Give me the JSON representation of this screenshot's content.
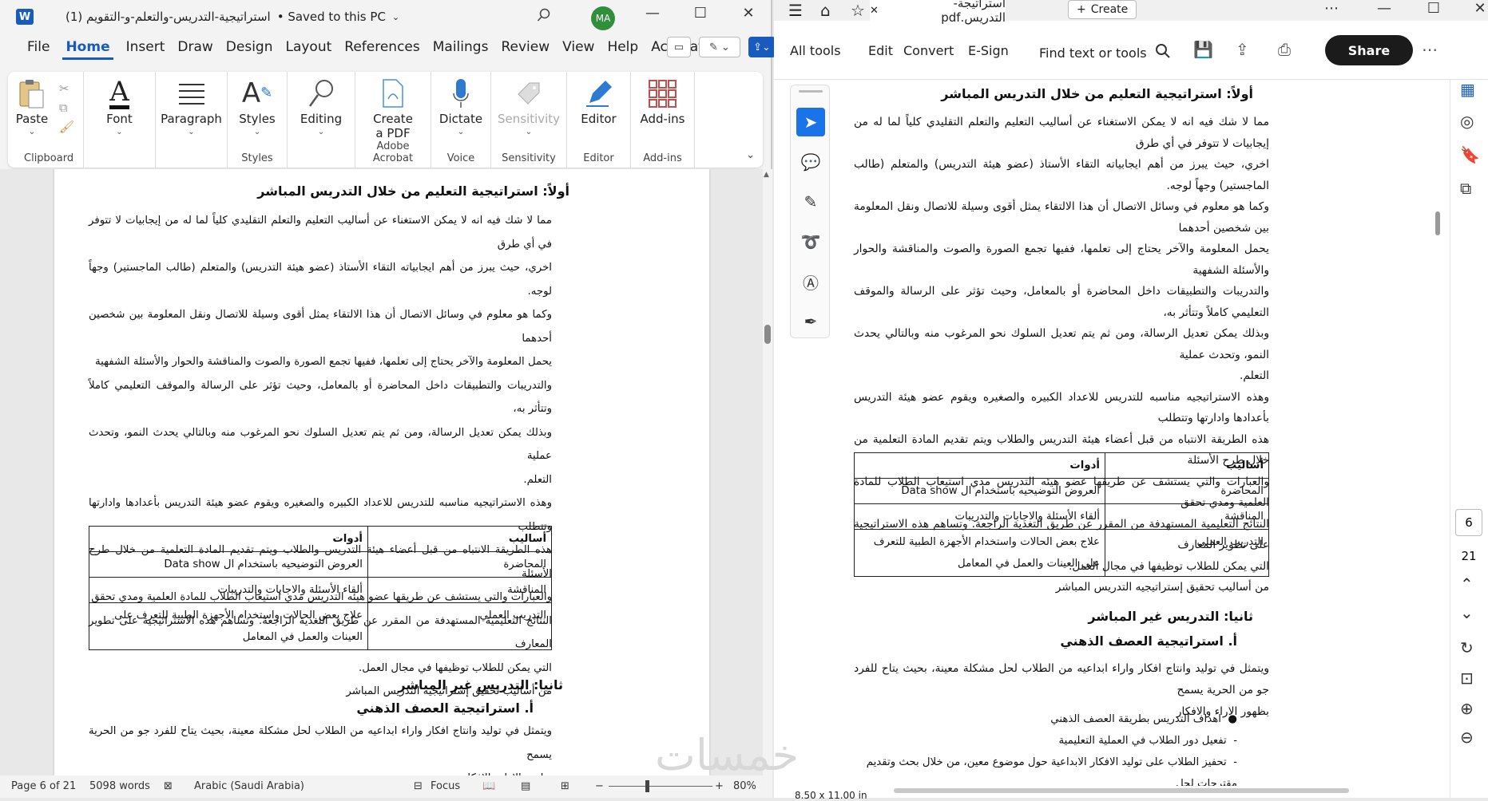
{
  "word": {
    "logo": "W",
    "title": "(1) استراتيجية-التدريس-والتعلم-و-التقويم",
    "saved": "• Saved to this PC",
    "avatar": "MA",
    "tabs": [
      "File",
      "Home",
      "Insert",
      "Draw",
      "Design",
      "Layout",
      "References",
      "Mailings",
      "Review",
      "View",
      "Help",
      "Acrobat"
    ],
    "ribbon": {
      "paste": "Paste",
      "clipboard": "Clipboard",
      "font": "Font",
      "paragraph": "Paragraph",
      "styles": "Styles",
      "styles_group": "Styles",
      "editing": "Editing",
      "create_pdf_1": "Create",
      "create_pdf_2": "a PDF",
      "adobe_acrobat": "Adobe Acrobat",
      "dictate": "Dictate",
      "voice": "Voice",
      "sensitivity": "Sensitivity",
      "sensitivity_group": "Sensitivity",
      "editor": "Editor",
      "editor_group": "Editor",
      "addins": "Add-ins",
      "addins_group": "Add-ins"
    },
    "status": {
      "page": "Page 6 of 21",
      "words": "5098 words",
      "language": "Arabic (Saudi Arabia)",
      "focus": "Focus",
      "zoom": "80%"
    }
  },
  "document": {
    "heading1": "أولاً: استراتيجية التعليم من خلال التدريس المباشر",
    "para1_lines": [
      "مما لا شك فيه انه لا يمكن الاستغناء عن أساليب التعليم والتعلم التقليدي كلياً لما له من إيجابيات لا تتوفر في أي طرق",
      "اخري، حيث يبرز من أهم ايجابياته التقاء الأستاذ (عضو هيئة التدريس) والمتعلم (طالب الماجستير) وجهاً لوجه.",
      "وكما هو معلوم في وسائل الاتصال أن هذا الالتقاء يمثل أقوى وسيلة للاتصال ونقل المعلومة بين شخصين أحدهما",
      "يحمل المعلومة والآخر يحتاج إلى تعلمها، ففيها تجمع الصورة والصوت والمناقشة والحوار والأسئلة الشفهية",
      "والتدريبات والتطبيقات داخل المحاضرة أو بالمعامل، وحيث تؤثر على الرسالة والموقف التعليمي كاملاً وتتأثر به،",
      "وبذلك يمكن تعديل الرسالة، ومن ثم يتم تعديل السلوك نحو المرغوب منه وبالتالي يحدث النمو، وتحدث عملية",
      "التعلم."
    ],
    "para2_lines": [
      "وهذه الاستراتيجيه مناسبه للتدريس للاعداد الكبيره والصغيره ويقوم عضو هيئة التدريس بأعدادها وادارتها وتتطلب",
      "هذه الطريقة الانتباه من قبل أعضاء هيئة التدريس والطلاب ويتم تقديم المادة التعلمية من خلال طرح الأسئلة",
      "والعبارات والتي يستشف عن طريقها عضو هيئه التدريس مدي استيعاب الطلاب للمادة العلمية ومدي تحقق",
      "النتائج التعليمية المستهدفة من المقرر عن طريق التغذية الراجعة. وتساهم هذه الاستراتيجية على تطوير المعارف",
      "التي يمكن للطلاب توظيفها في مجال العمل."
    ],
    "para3": "من أساليب تحقيق إستراتيجيه التدريس المباشر",
    "table": {
      "headers": [
        "أساليب",
        "أدوات"
      ],
      "rows": [
        [
          "المحاضرة",
          "العروض التوضيحيه باستخدام ال Data show"
        ],
        [
          "المناقشة",
          "ألقاء الأسئلة والاجابات والتدريبات"
        ],
        [
          "التدريب العملي",
          "علاج بعض الحالات واستخدام الأجهزة الطبية للتعرف على العينات والعمل في المعامل"
        ]
      ]
    },
    "heading2": "ثانيا: التدريس غير المباشر",
    "heading3": "أ. استراتيجية العصف الذهني",
    "para4_lines": [
      "ويتمثل في توليد وانتاج افكار واراء ابداعيه من الطلاب لحل مشكلة معينة، بحيث يتاح للفرد جو من الحرية يسمح",
      "بظهور الاراء والافكار"
    ],
    "bullets": [
      "اهداف التدريس بطريقة العصف الذهني",
      "تفعيل دور الطلاب في العملية التعليمية",
      "تحفيز الطلاب على توليد الافكار الابداعية حول موضوع معين، من خلال بحث وتقديم مقترحات لحل"
    ]
  },
  "acrobat": {
    "tab_title": "استراتيجة-التدريس.pdf",
    "create": "Create",
    "toolbar": [
      "All tools",
      "Edit",
      "Convert",
      "E-Sign"
    ],
    "find": "Find text or tools",
    "share": "Share",
    "page_current": "6",
    "page_total": "21",
    "dimensions": "8.50 x 11.00 in"
  },
  "watermark": "خمسات"
}
